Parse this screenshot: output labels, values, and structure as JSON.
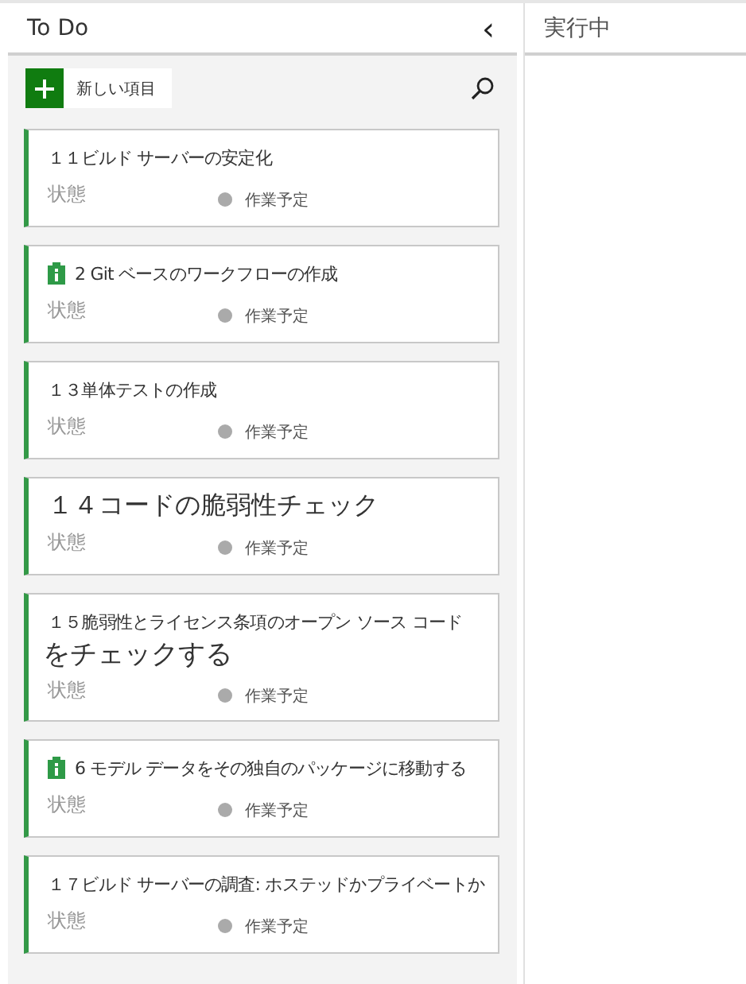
{
  "columns": [
    {
      "title": "To Do",
      "collapse_glyph": "‹"
    },
    {
      "title": "実行中"
    }
  ],
  "toolbar": {
    "new_item": "新しい項目"
  },
  "cards": [
    {
      "kind": "plain",
      "title": "１１ビルド サーバーの安定化",
      "emphasized": false,
      "field_label": "状態",
      "state": "作業予定"
    },
    {
      "kind": "task",
      "title": "2 Git ベースのワークフローの作成",
      "emphasized": false,
      "field_label": "状態",
      "state": "作業予定"
    },
    {
      "kind": "plain",
      "title": "１３単体テストの作成",
      "emphasized": false,
      "field_label": "状態",
      "state": "作業予定"
    },
    {
      "kind": "plain",
      "title": "１４コードの脆弱性チェック",
      "emphasized": true,
      "field_label": "状態",
      "state": "作業予定"
    },
    {
      "kind": "plain",
      "title": "１５脆弱性とライセンス条項のオープン ソース コード",
      "title_cont": "をチェックする",
      "emphasized": false,
      "field_label": "状態",
      "state": "作業予定"
    },
    {
      "kind": "task",
      "title": "6 モデル データをその独自のパッケージに移動する",
      "emphasized": false,
      "field_label": "状態",
      "state": "作業予定"
    },
    {
      "kind": "plain",
      "title": "１７ビルド サーバーの調査: ホステッドかプライベートか",
      "emphasized": false,
      "field_label": "状態",
      "state": "作業予定"
    }
  ]
}
